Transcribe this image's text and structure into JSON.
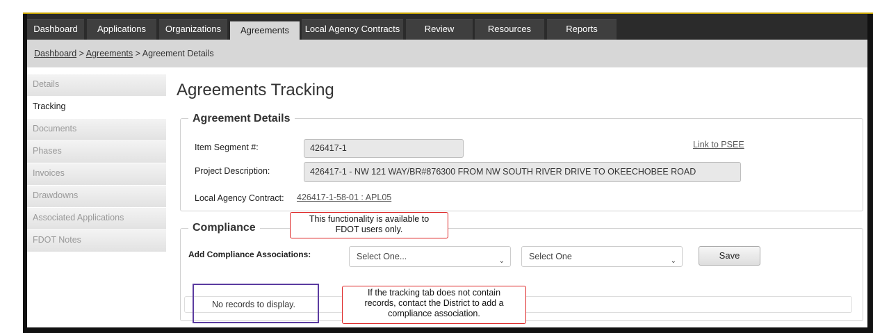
{
  "nav": {
    "tabs": [
      {
        "label": "Dashboard"
      },
      {
        "label": "Applications"
      },
      {
        "label": "Organizations"
      },
      {
        "label": "Agreements"
      },
      {
        "label": "Local Agency Contracts"
      },
      {
        "label": "Review"
      },
      {
        "label": "Resources"
      },
      {
        "label": "Reports"
      }
    ]
  },
  "breadcrumb": {
    "home": "Dashboard",
    "sep": ">",
    "section": "Agreements",
    "current": "Agreement Details"
  },
  "sidebar": {
    "items": [
      {
        "label": "Details"
      },
      {
        "label": "Tracking"
      },
      {
        "label": "Documents"
      },
      {
        "label": "Phases"
      },
      {
        "label": "Invoices"
      },
      {
        "label": "Drawdowns"
      },
      {
        "label": "Associated Applications"
      },
      {
        "label": "FDOT Notes"
      }
    ]
  },
  "page": {
    "title": "Agreements Tracking"
  },
  "agreement_details": {
    "legend": "Agreement Details",
    "item_segment_label": "Item Segment #:",
    "item_segment_value": "426417-1",
    "link_psee": "Link to PSEE",
    "project_desc_label": "Project Description:",
    "project_desc_value": "426417-1 - NW 121 WAY/BR#876300 FROM NW SOUTH RIVER DRIVE TO OKEECHOBEE ROAD",
    "local_contract_label": "Local Agency Contract:",
    "local_contract_value": "426417-1-58-01 : APL05"
  },
  "compliance": {
    "legend": "Compliance",
    "add_label": "Add Compliance Associations:",
    "select1": "Select One...",
    "select2": "Select One",
    "save": "Save",
    "no_records": "No records to display."
  },
  "callouts": {
    "fdot_only_line1": "This functionality is available to",
    "fdot_only_line2": "FDOT users only.",
    "tracking_line1": "If the tracking tab does not contain",
    "tracking_line2": "records, contact the District to add a",
    "tracking_line3": "compliance association."
  }
}
